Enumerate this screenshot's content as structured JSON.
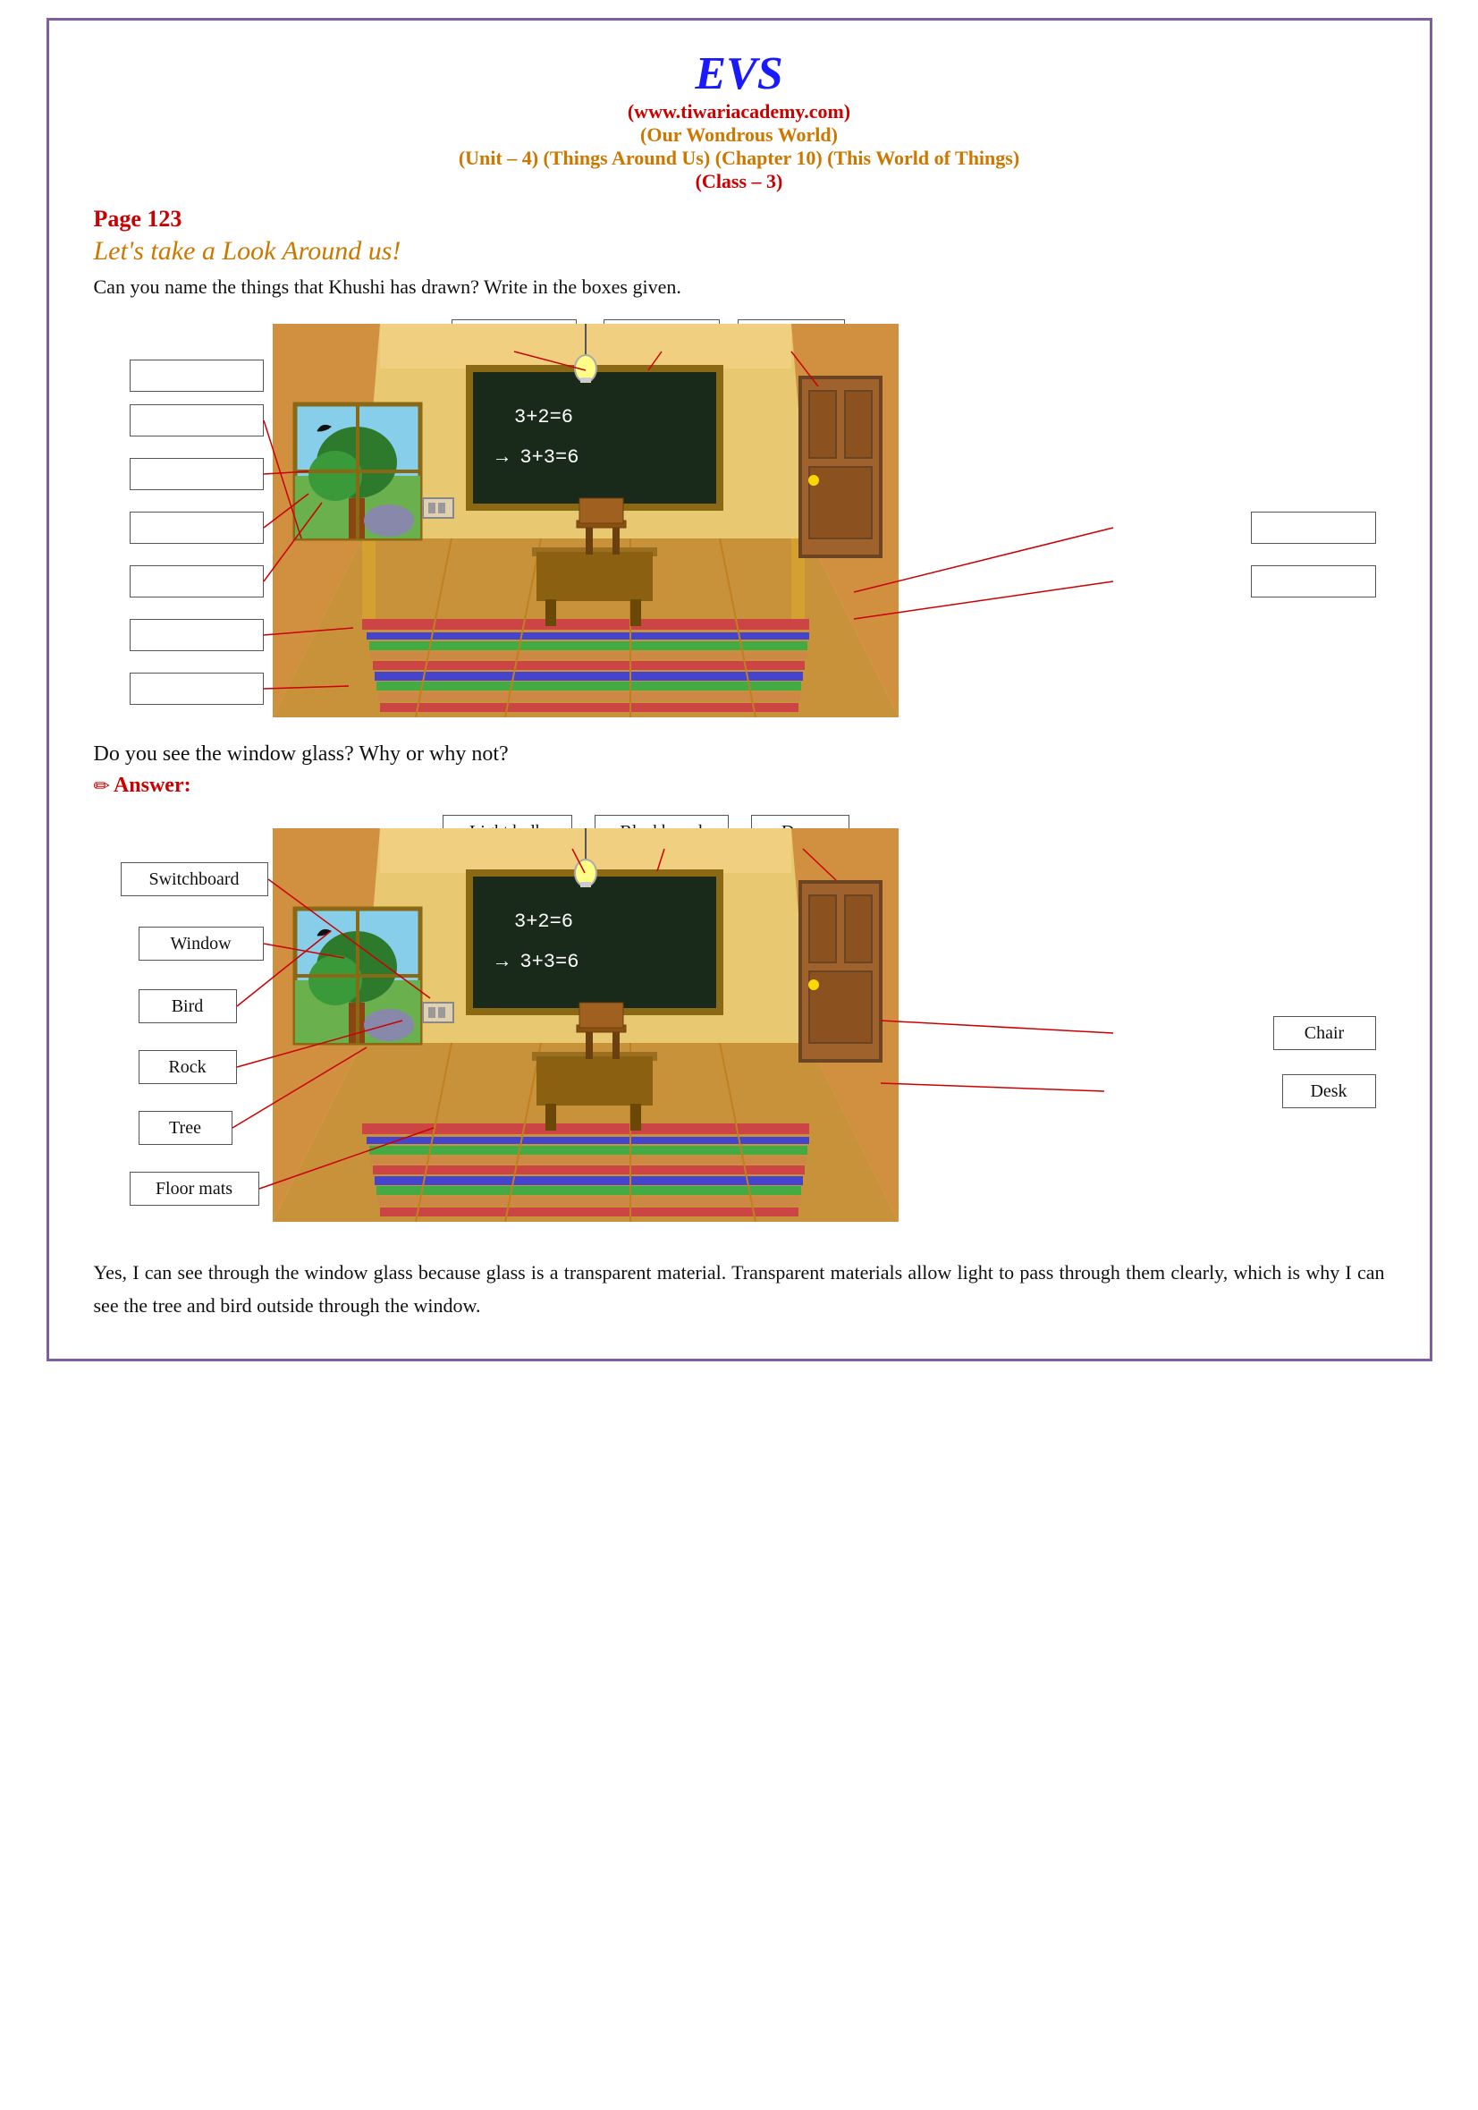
{
  "header": {
    "title": "EVS",
    "website": "(www.tiwariacademy.com)",
    "subtitle1": "(Our Wondrous World)",
    "subtitle2": "(Unit – 4) (Things Around Us) (Chapter 10) (This World of Things)",
    "subtitle3": "(Class – 3)"
  },
  "page": {
    "number": "Page 123",
    "section_title": "Let's take a Look Around us!",
    "instruction": "Can you name the things that Khushi has drawn? Write in the boxes given.",
    "question": "Do you see the window glass? Why or why not?",
    "answer_label": "Answer:",
    "answer_text": "Yes, I can see through the window glass because glass is a transparent material. Transparent materials allow light to pass through them clearly, which is why I can see the tree and bird outside through the window."
  },
  "labels_top": {
    "box1": "",
    "box2": "",
    "box3": ""
  },
  "labels_left": {
    "box1": "",
    "box2": "",
    "box3": "",
    "box4": "",
    "box5": "",
    "box6": ""
  },
  "labels_right": {
    "box1": "",
    "box2": ""
  },
  "answered_labels_top": {
    "light_bulb": "Light bulb",
    "blackboard": "Blackboard",
    "door": "Door"
  },
  "answered_labels_left": {
    "switchboard": "Switchboard",
    "window": "Window",
    "bird": "Bird",
    "rock": "Rock",
    "tree": "Tree",
    "floor_mats": "Floor mats"
  },
  "answered_labels_right": {
    "chair": "Chair",
    "desk": "Desk"
  },
  "blackboard_text": {
    "line1": "3+2=6",
    "line2": "→ 3+3=6"
  }
}
